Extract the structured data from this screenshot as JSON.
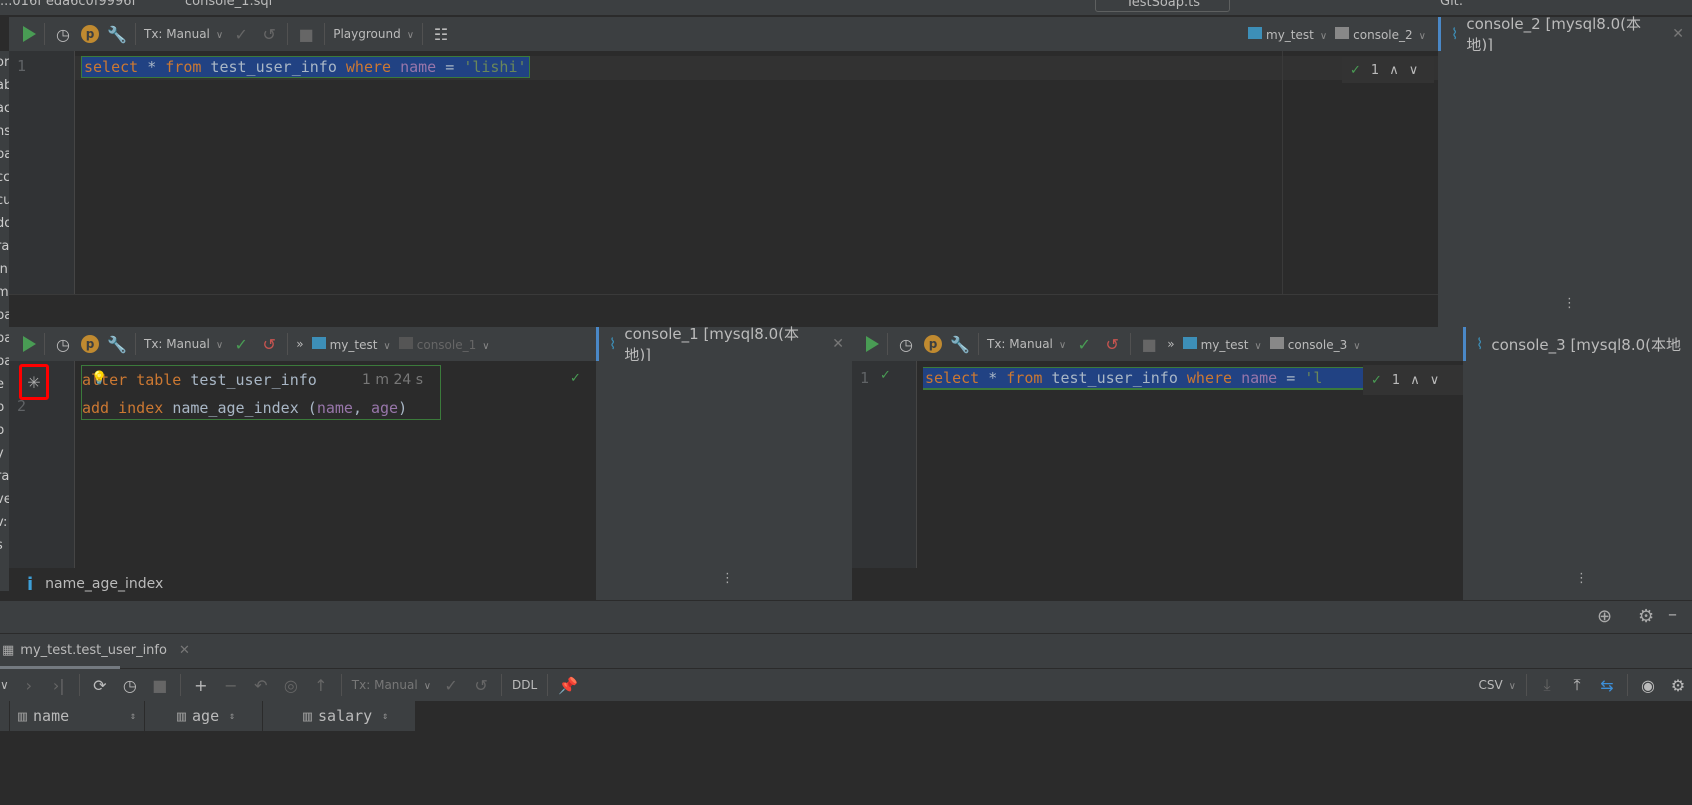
{
  "titlebar": {
    "path": "...016f eda6c0f9996f",
    "file": "console_1.sql",
    "run_config": "TestSoap.ts",
    "git_label": "Git:"
  },
  "left_strip": [
    "or",
    "ab",
    "ac",
    "ns",
    "pa",
    "cc",
    "cu",
    "do",
    "ra",
    "in",
    "m",
    "pa",
    "pa",
    "pa",
    "e",
    "p",
    "p",
    "y",
    "ra",
    "ve",
    "v:",
    "s"
  ],
  "top_console": {
    "toolbar": {
      "tx": "Tx: Manual",
      "mode": "Playground",
      "schema": "my_test",
      "session": "console_2"
    },
    "tab": "console_2 [mysql8.0(本地)]",
    "line": "1",
    "code": {
      "k1": "select",
      "op": " * ",
      "k2": "from",
      "t": " test_user_info ",
      "k3": "where",
      "c": "name",
      "eq": " = ",
      "s": "'lishi'"
    },
    "inspection_count": "1"
  },
  "console_1": {
    "toolbar": {
      "tx": "Tx: Manual",
      "more": "»",
      "schema": "my_test",
      "session": "console_1"
    },
    "tab": "console_1 [mysql8.0(本地)]",
    "lines": [
      "1",
      "2"
    ],
    "code1": {
      "k1": "alter",
      "k2": "table",
      "t": "test_user_info"
    },
    "code2": {
      "k1": "add",
      "k2": "index",
      "t": "name_age_index",
      "p1": "(",
      "c1": "name",
      ",": ", ",
      "c2": "age",
      "p2": ")"
    },
    "elapsed": "1 m 24 s",
    "info": "name_age_index"
  },
  "console_3": {
    "toolbar": {
      "tx": "Tx: Manual",
      "more": "»",
      "schema": "my_test",
      "session": "console_3"
    },
    "tab": "console_3 [mysql8.0(本地",
    "line": "1",
    "code": {
      "k1": "select",
      "op": " * ",
      "k2": "from",
      "t": " test_user_info ",
      "k3": "where",
      "c": "name",
      "eq": " = ",
      "s": "'l"
    },
    "inspection_count": "1"
  },
  "results": {
    "tab": "my_test.test_user_info",
    "tx": "Tx: Manual",
    "ddl": "DDL",
    "export": "CSV",
    "columns": [
      "name",
      "age",
      "salary"
    ]
  },
  "colors": {
    "accent": "#4a88c7",
    "run": "#499c54",
    "highlight": "#ff0000"
  }
}
